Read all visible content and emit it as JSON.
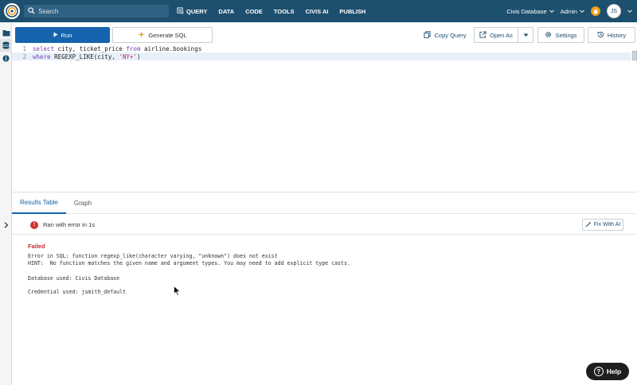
{
  "nav": {
    "search_placeholder": "Search",
    "items": [
      {
        "label": "QUERY",
        "icon": "query-icon"
      },
      {
        "label": "DATA"
      },
      {
        "label": "CODE"
      },
      {
        "label": "TOOLS"
      },
      {
        "label": "CIVIS AI"
      },
      {
        "label": "PUBLISH"
      }
    ],
    "database_label": "Civis Database",
    "admin_label": "Admin",
    "avatar_initials": "JS",
    "brand_color": "#1d4f6e"
  },
  "toolbar": {
    "run_label": "Run",
    "generate_label": "Generate SQL",
    "copy_label": "Copy Query",
    "open_as_label": "Open As",
    "settings_label": "Settings",
    "history_label": "History"
  },
  "editor": {
    "line_numbers": [
      "1",
      "2"
    ],
    "line1": {
      "kw1": "select",
      "t1": " city, ticket_price ",
      "kw2": "from",
      "t2": " airline.bookings"
    },
    "line2": {
      "kw1": "where",
      "t1": " REGEXP_LIKE(city, ",
      "str": "'NY+'",
      "t2": ")"
    }
  },
  "results": {
    "tabs": [
      "Results Table",
      "Graph"
    ],
    "status": "Ran with error in 1s",
    "fix_label": "Fix With AI",
    "failed_label": "Failed",
    "error_line1": "Error in SQL: function regexp_like(character varying, \"unknown\") does not exist",
    "error_line2": "HINT:  No function matches the given name and argument types. You may need to add explicit type casts.",
    "database_used": "Database used: Civis Database",
    "credential_used": "Credential used: jsmith_default"
  },
  "help_label": "Help"
}
